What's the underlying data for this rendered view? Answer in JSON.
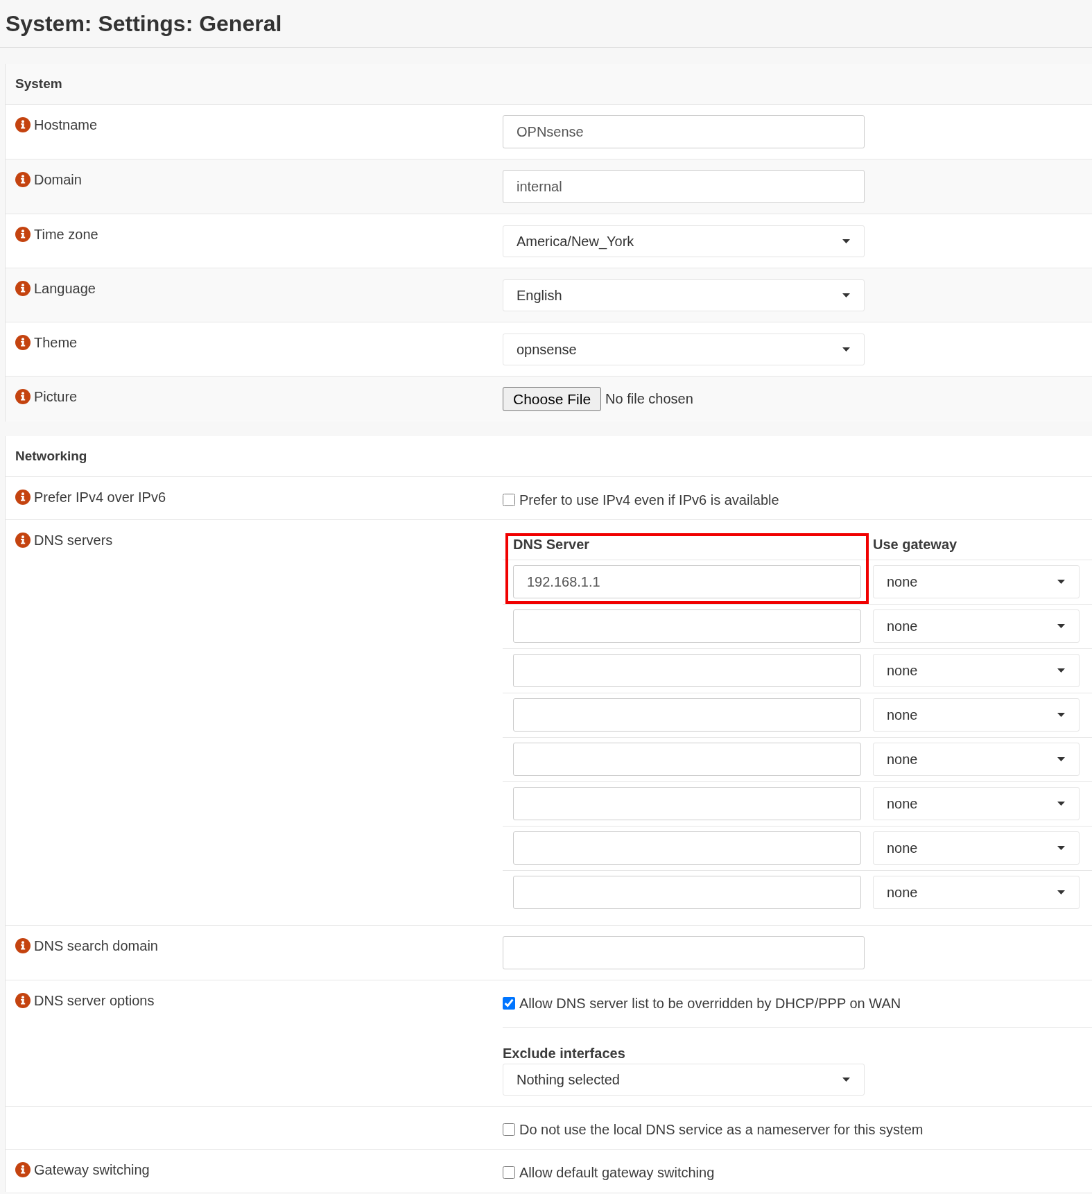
{
  "page": {
    "title": "System: Settings: General"
  },
  "sections": [
    {
      "title": "System",
      "striped": true,
      "rows": [
        {
          "kind": "text",
          "label": "Hostname",
          "value": "OPNsense"
        },
        {
          "kind": "text",
          "label": "Domain",
          "value": "internal"
        },
        {
          "kind": "select",
          "label": "Time zone",
          "value": "America/New_York"
        },
        {
          "kind": "select",
          "label": "Language",
          "value": "English"
        },
        {
          "kind": "select",
          "label": "Theme",
          "value": "opnsense"
        },
        {
          "kind": "file",
          "label": "Picture",
          "button": "Choose File",
          "status": "No file chosen"
        }
      ]
    },
    {
      "title": "Networking",
      "striped": false,
      "rows": [
        {
          "kind": "checkbox",
          "label": "Prefer IPv4 over IPv6",
          "checked": false,
          "text": "Prefer to use IPv4 even if IPv6 is available"
        },
        {
          "kind": "dns-table",
          "label": "DNS servers",
          "columns": [
            "DNS Server",
            "Use gateway"
          ],
          "entries": [
            {
              "server": "192.168.1.1",
              "gateway": "none",
              "highlighted": true
            },
            {
              "gateway": "none",
              "highlighted": false
            },
            {
              "gateway": "none",
              "highlighted": false
            },
            {
              "gateway": "none",
              "highlighted": false
            },
            {
              "gateway": "none",
              "highlighted": false
            },
            {
              "gateway": "none",
              "highlighted": false
            },
            {
              "gateway": "none",
              "highlighted": false
            },
            {
              "gateway": "none",
              "highlighted": false
            }
          ]
        },
        {
          "kind": "text",
          "label": "DNS search domain"
        },
        {
          "kind": "options",
          "label": "DNS server options",
          "checkbox": {
            "checked": true,
            "text": "Allow DNS server list to be overridden by DHCP/PPP on WAN"
          },
          "select": {
            "label": "Exclude interfaces",
            "value": "Nothing selected"
          }
        },
        {
          "kind": "checkbox",
          "checked": false,
          "text": "Do not use the local DNS service as a nameserver for this system"
        },
        {
          "kind": "checkbox",
          "label": "Gateway switching",
          "checked": false,
          "text": "Allow default gateway switching"
        }
      ]
    }
  ]
}
